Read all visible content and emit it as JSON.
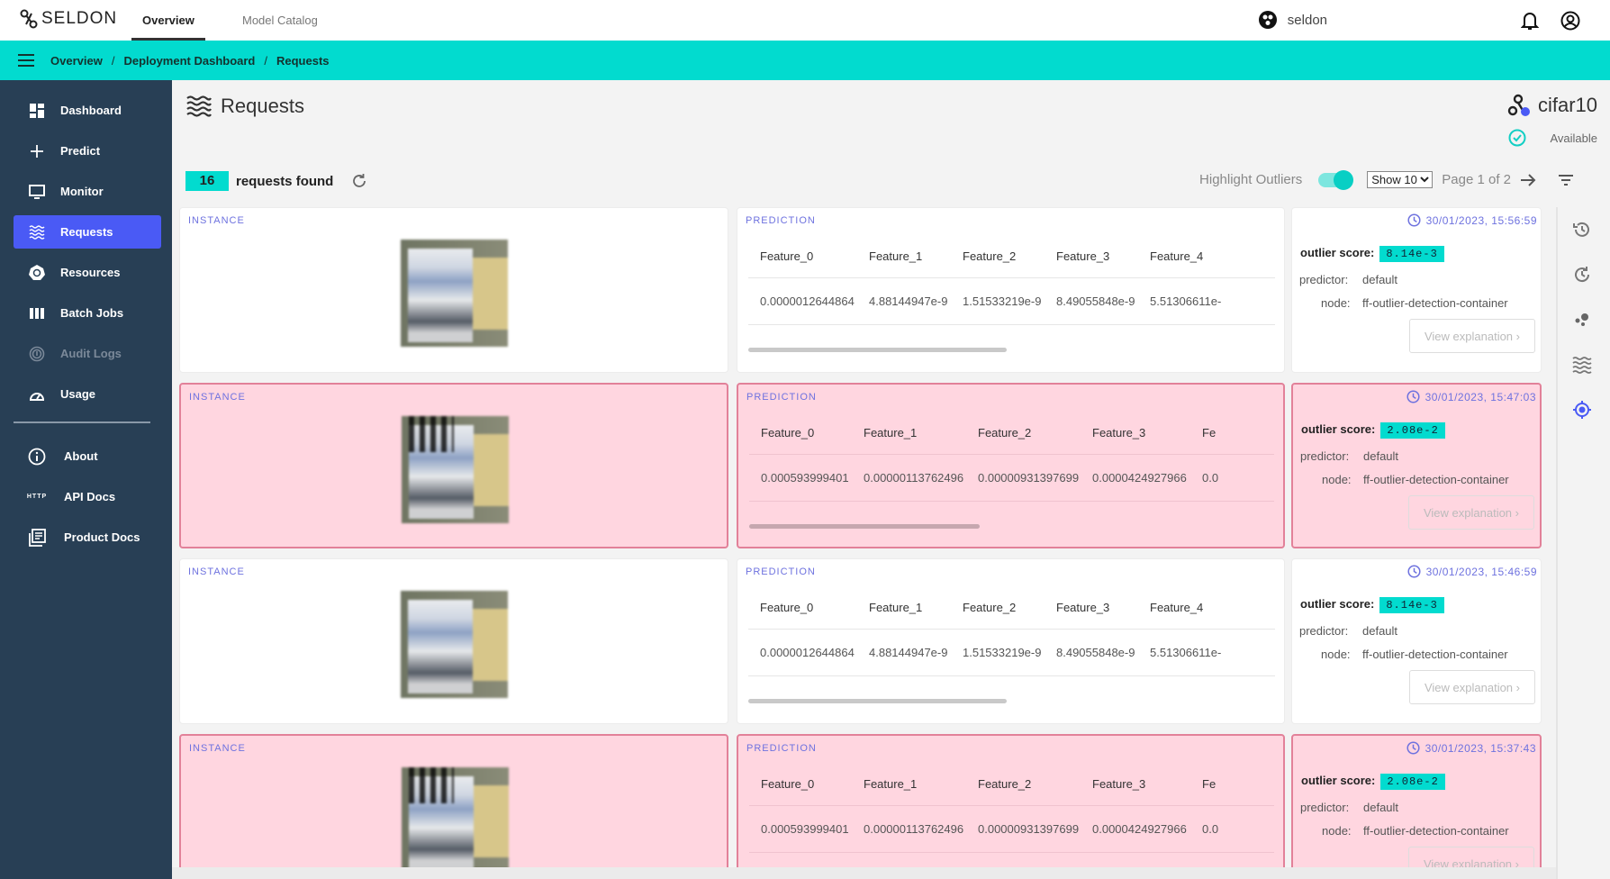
{
  "brand": {
    "name": "SELDON"
  },
  "topnav": {
    "tabs": [
      {
        "label": "Overview",
        "active": true
      },
      {
        "label": "Model Catalog",
        "active": false
      }
    ],
    "user": "seldon"
  },
  "breadcrumb": [
    "Overview",
    "Deployment Dashboard",
    "Requests"
  ],
  "sidebar": {
    "items": [
      {
        "label": "Dashboard",
        "icon": "dashboard-icon"
      },
      {
        "label": "Predict",
        "icon": "plus-icon"
      },
      {
        "label": "Monitor",
        "icon": "monitor-icon"
      },
      {
        "label": "Requests",
        "icon": "waves-icon",
        "active": true
      },
      {
        "label": "Resources",
        "icon": "kubernetes-icon"
      },
      {
        "label": "Batch Jobs",
        "icon": "columns-icon"
      },
      {
        "label": "Audit Logs",
        "icon": "fingerprint-icon",
        "disabled": true
      },
      {
        "label": "Usage",
        "icon": "gauge-icon"
      }
    ],
    "secondary": [
      {
        "label": "About",
        "icon": "info-icon"
      },
      {
        "label": "API Docs",
        "icon": "http-icon",
        "icon_text": "HTTP"
      },
      {
        "label": "Product Docs",
        "icon": "docs-icon"
      }
    ]
  },
  "page": {
    "title": "Requests",
    "model": "cifar10",
    "status": "Available"
  },
  "results": {
    "count": "16",
    "count_label": "requests found",
    "highlight_label": "Highlight Outliers",
    "highlight_on": true,
    "show_value": "Show 10",
    "page_label": "Page 1 of 2"
  },
  "labels": {
    "instance": "INSTANCE",
    "prediction": "PREDICTION",
    "outlier_score": "outlier score:",
    "predictor": "predictor:",
    "node": "node:",
    "view_explanation": "View explanation"
  },
  "colors": {
    "accent": "#02dbcf",
    "sidebar": "#283f55",
    "active": "#4a5af5",
    "outlier_bg": "#ffd6e0",
    "outlier_border": "#e28199",
    "label": "#6e72df"
  },
  "requests": [
    {
      "outlier": false,
      "timestamp": "30/01/2023, 15:56:59",
      "score": "8.14e-3",
      "predictor": "default",
      "node": "ff-outlier-detection-container",
      "headers": [
        "Feature_0",
        "Feature_1",
        "Feature_2",
        "Feature_3",
        "Feature_4"
      ],
      "values": [
        "0.0000012644864",
        "4.88144947e-9",
        "1.51533219e-9",
        "8.49055848e-9",
        "5.51306611e-"
      ]
    },
    {
      "outlier": true,
      "timestamp": "30/01/2023, 15:47:03",
      "score": "2.08e-2",
      "predictor": "default",
      "node": "ff-outlier-detection-container",
      "headers": [
        "Feature_0",
        "Feature_1",
        "Feature_2",
        "Feature_3",
        "Fe"
      ],
      "values": [
        "0.000593999401",
        "0.00000113762496",
        "0.00000931397699",
        "0.0000424927966",
        "0.0"
      ]
    },
    {
      "outlier": false,
      "timestamp": "30/01/2023, 15:46:59",
      "score": "8.14e-3",
      "predictor": "default",
      "node": "ff-outlier-detection-container",
      "headers": [
        "Feature_0",
        "Feature_1",
        "Feature_2",
        "Feature_3",
        "Feature_4"
      ],
      "values": [
        "0.0000012644864",
        "4.88144947e-9",
        "1.51533219e-9",
        "8.49055848e-9",
        "5.51306611e-"
      ]
    },
    {
      "outlier": true,
      "timestamp": "30/01/2023, 15:37:43",
      "score": "2.08e-2",
      "predictor": "default",
      "node": "ff-outlier-detection-container",
      "headers": [
        "Feature_0",
        "Feature_1",
        "Feature_2",
        "Feature_3",
        "Fe"
      ],
      "values": [
        "0.000593999401",
        "0.00000113762496",
        "0.00000931397699",
        "0.0000424927966",
        "0.0"
      ]
    }
  ]
}
